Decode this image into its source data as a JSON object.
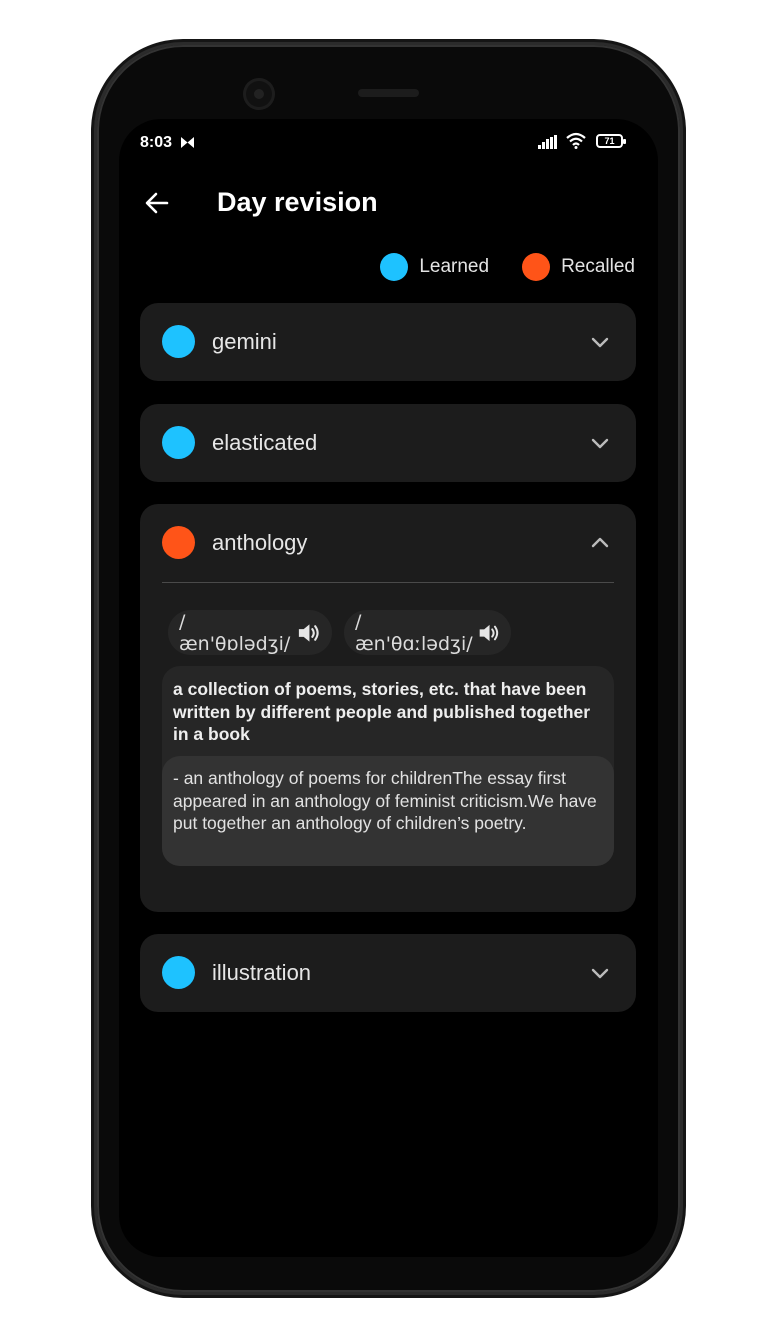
{
  "status_bar": {
    "time": "8:03",
    "battery": "71"
  },
  "header": {
    "title": "Day revision"
  },
  "legend": [
    {
      "label": "Learned",
      "color": "#1EC2FF"
    },
    {
      "label": "Recalled",
      "color": "#FF5418"
    }
  ],
  "colors": {
    "learned": "#1EC2FF",
    "recalled": "#FF5418",
    "card": "#1c1c1c"
  },
  "words": [
    {
      "word": "gemini",
      "status": "learned",
      "expanded": false
    },
    {
      "word": "elasticated",
      "status": "learned",
      "expanded": false
    },
    {
      "word": "anthology",
      "status": "recalled",
      "expanded": true,
      "pronunciations": [
        "/æn'θɒlədʒi/",
        "/æn'θɑːlədʒi/"
      ],
      "definition": "a collection of poems, stories, etc. that have been written by different people and published together in a book",
      "examples": "- an anthology of poems for childrenThe essay first appeared in an anthology of feminist criticism.We have put together an anthology of children’s poetry."
    },
    {
      "word": "illustration",
      "status": "learned",
      "expanded": false
    }
  ]
}
